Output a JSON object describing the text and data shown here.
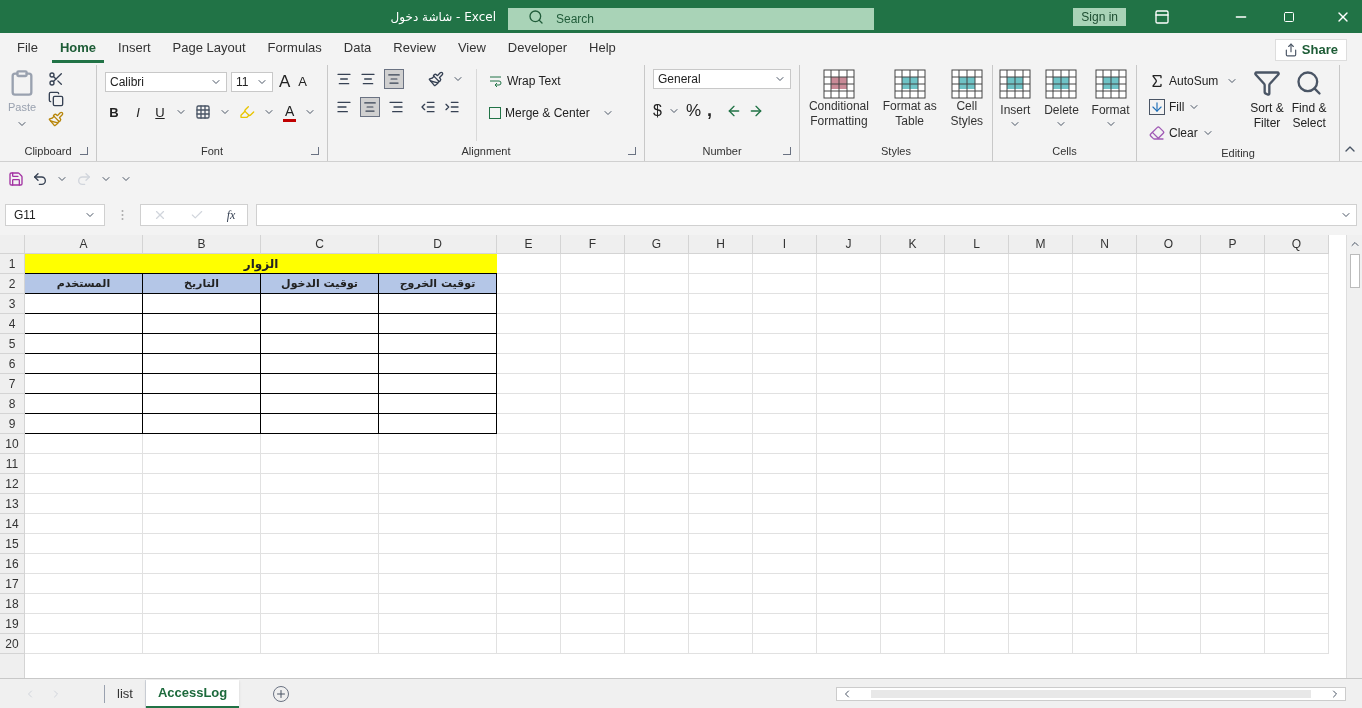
{
  "window": {
    "title": "شاشة دخول  -  Excel",
    "search": {
      "placeholder": "Search"
    },
    "sign_in": "Sign in"
  },
  "menu_tabs": [
    {
      "label": "File",
      "selected": false
    },
    {
      "label": "Home",
      "selected": true
    },
    {
      "label": "Insert",
      "selected": false
    },
    {
      "label": "Page Layout",
      "selected": false
    },
    {
      "label": "Formulas",
      "selected": false
    },
    {
      "label": "Data",
      "selected": false
    },
    {
      "label": "Review",
      "selected": false
    },
    {
      "label": "View",
      "selected": false
    },
    {
      "label": "Developer",
      "selected": false
    },
    {
      "label": "Help",
      "selected": false
    }
  ],
  "share": "Share",
  "ribbon": {
    "clipboard": {
      "label": "Clipboard",
      "paste": "Paste"
    },
    "font": {
      "label": "Font",
      "font_name": "Calibri",
      "font_size": "11",
      "grow": "A",
      "shrink": "A",
      "bold": "B",
      "italic": "I",
      "underline": "U",
      "font_color": "A"
    },
    "alignment": {
      "label": "Alignment",
      "wrap_text": "Wrap Text",
      "merge": "Merge & Center"
    },
    "number": {
      "label": "Number",
      "format": "General",
      "currency": "$",
      "percent": "%",
      "comma": ","
    },
    "styles": {
      "label": "Styles",
      "buttons": [
        {
          "lines": [
            "Conditional",
            "Formatting"
          ]
        },
        {
          "lines": [
            "Format as",
            "Table"
          ]
        },
        {
          "lines": [
            "Cell",
            "Styles"
          ]
        }
      ]
    },
    "cells": {
      "label": "Cells",
      "buttons": [
        "Insert",
        "Delete",
        "Format"
      ]
    },
    "editing": {
      "label": "Editing",
      "autosum": "AutoSum",
      "fill": "Fill",
      "clear": "Clear",
      "sort": [
        "Sort &",
        "Filter"
      ],
      "find": [
        "Find &",
        "Select"
      ]
    }
  },
  "formula_bar": {
    "name_box": "G11",
    "fx": "fx"
  },
  "sheet": {
    "columns": [
      "A",
      "B",
      "C",
      "D",
      "E",
      "F",
      "G",
      "H",
      "I",
      "J",
      "K",
      "L",
      "M",
      "N",
      "O",
      "P",
      "Q"
    ],
    "title": "الزوار",
    "header_cells": {
      "A": "المستخدم",
      "B": "التاريخ",
      "C": "توقيت الدخول",
      "D": "توقيت الخروج"
    },
    "rows": [
      {
        "label": "1",
        "kind": "title"
      },
      {
        "label": "2",
        "kind": "header"
      },
      {
        "label": "3",
        "kind": "table"
      },
      {
        "label": "4",
        "kind": "table"
      },
      {
        "label": "5",
        "kind": "table"
      },
      {
        "label": "6",
        "kind": "table"
      },
      {
        "label": "7",
        "kind": "table"
      },
      {
        "label": "8",
        "kind": "table"
      },
      {
        "label": "9",
        "kind": "table"
      },
      {
        "label": "10",
        "kind": "blank"
      },
      {
        "label": "11",
        "kind": "blank"
      },
      {
        "label": "12",
        "kind": "blank"
      },
      {
        "label": "13",
        "kind": "blank"
      },
      {
        "label": "14",
        "kind": "blank"
      },
      {
        "label": "15",
        "kind": "blank"
      },
      {
        "label": "16",
        "kind": "blank"
      },
      {
        "label": "17",
        "kind": "blank"
      },
      {
        "label": "18",
        "kind": "blank"
      },
      {
        "label": "19",
        "kind": "blank"
      },
      {
        "label": "20",
        "kind": "blank"
      }
    ]
  },
  "sheet_tabs": [
    {
      "label": "list",
      "selected": false
    },
    {
      "label": "AccessLog",
      "selected": true
    }
  ]
}
